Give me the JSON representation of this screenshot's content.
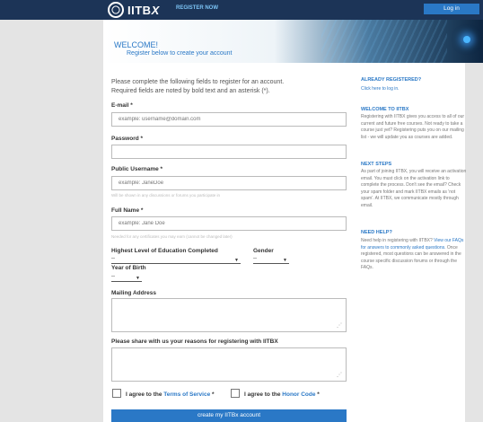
{
  "header": {
    "logo_text": "IITB",
    "logo_x": "X",
    "register_now": "REGISTER NOW",
    "login": "Log in"
  },
  "banner": {
    "title": "WELCOME!",
    "subtitle": "Register below to create your account"
  },
  "form": {
    "intro": "Please complete the following fields to register for an account.",
    "required_note": "Required fields are noted by bold text and an asterisk (*).",
    "email_label": "E-mail *",
    "email_placeholder": "example: username@domain.com",
    "password_label": "Password *",
    "username_label": "Public Username *",
    "username_placeholder": "example: JaneDoe",
    "username_hint": "Will be shown in any discussions or forums you participate in",
    "fullname_label": "Full Name *",
    "fullname_placeholder": "example: Jane Doe",
    "fullname_hint": "Needed for any certificates you may earn (cannot be changed later)",
    "education_label": "Highest Level of Education Completed",
    "education_value": "--",
    "gender_label": "Gender",
    "gender_value": "--",
    "birth_label": "Year of Birth",
    "birth_value": "--",
    "address_label": "Mailing Address",
    "goals_label": "Please share with us your reasons for registering with IITBX",
    "tos_prefix": "I agree to the",
    "tos_link": "Terms of Service",
    "tos_suffix": " *",
    "honor_prefix": "I agree to the",
    "honor_link": "Honor Code",
    "honor_suffix": " *",
    "submit": "create my IITBx account"
  },
  "sidebar": {
    "registered_title": "ALREADY REGISTERED?",
    "registered_link": "Click here to log in.",
    "welcome_title": "WELCOME TO IITBX",
    "welcome_text": "Registering with IITBX gives you access to all of our current and future free courses. Not ready to take a course just yet? Registering puts you on our mailing list - we will update you as courses are added.",
    "next_title": "NEXT STEPS",
    "next_text": "As part of joining IITBX, you will receive an activation email. You must click on the activation link to complete the process. Don't see the email? Check your spam folder and mark IITBX emails as 'not spam'. At IITBX, we communicate mostly through email.",
    "help_title": "NEED HELP?",
    "help_text_a": "Need help in registering with IITBX?",
    "help_link": "View our FAQs for answers to commonly asked questions.",
    "help_text_b": " Once registered, most questions can be answered in the course specific discussion forums or through the FAQs."
  },
  "colors": {
    "header_bg": "#1c3457",
    "accent": "#2a78c6"
  }
}
